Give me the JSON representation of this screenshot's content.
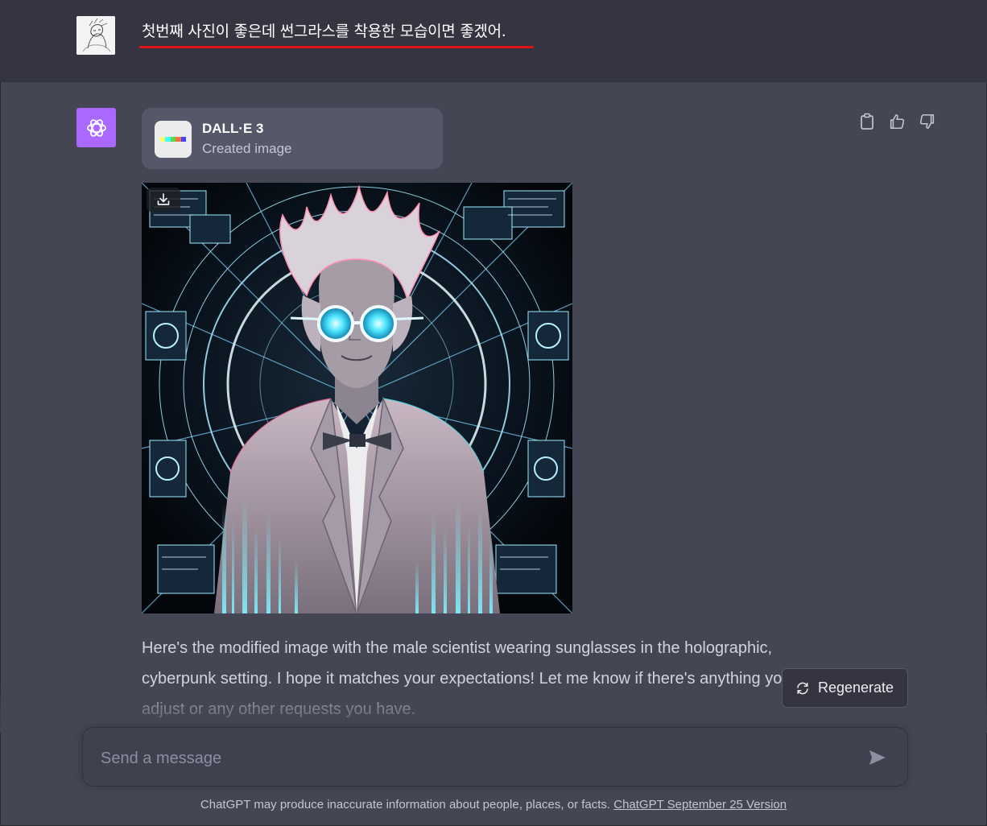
{
  "user_message": {
    "text": "첫번째 사진이 좋은데 썬그라스를 착용한 모습이면 좋겠어."
  },
  "tool": {
    "name": "DALL·E 3",
    "status": "Created image"
  },
  "reply": {
    "text": "Here's the modified image with the male scientist wearing sunglasses in the holographic, cyberpunk setting. I hope it matches your expectations! Let me know if there's anything you'd like to adjust or any other requests you have."
  },
  "regenerate": {
    "label": "Regenerate"
  },
  "composer": {
    "placeholder": "Send a message"
  },
  "footer": {
    "disclaimer": "ChatGPT may produce inaccurate information about people, places, or facts. ",
    "version_link": "ChatGPT September 25 Version"
  },
  "icons": {
    "user_avatar": "sketch-avatar",
    "assistant_avatar": "openai-logo-icon",
    "copy": "clipboard-icon",
    "like": "thumbs-up-icon",
    "dislike": "thumbs-down-icon",
    "download": "download-icon",
    "regenerate": "refresh-icon",
    "send": "send-icon"
  },
  "colors": {
    "accent_purple": "#ab68ff",
    "annotation_red": "#e01414",
    "background": "#444654",
    "user_row": "#343541"
  }
}
